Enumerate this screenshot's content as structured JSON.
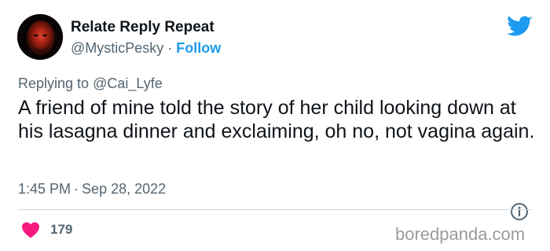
{
  "tweet": {
    "author_name": "Relate Reply Repeat",
    "author_handle": "@MysticPesky",
    "separator": "·",
    "follow_label": "Follow",
    "replying_prefix": "Replying to",
    "replying_handle": "@Cai_Lyfe",
    "text": "A friend of mine told the story of her child looking down at his lasagna dinner and exclaiming, oh no, not vagina again.",
    "time": "1:45 PM",
    "date": "Sep 28, 2022",
    "like_count": "179"
  },
  "icons": {
    "brand": "twitter-bird-icon",
    "info": "info-icon",
    "like": "heart-icon"
  },
  "colors": {
    "accent": "#1d9bf0",
    "heart": "#f91880",
    "secondary_text": "#536471",
    "watermark": "#9b9b9b"
  },
  "watermark": "boredpanda.com"
}
